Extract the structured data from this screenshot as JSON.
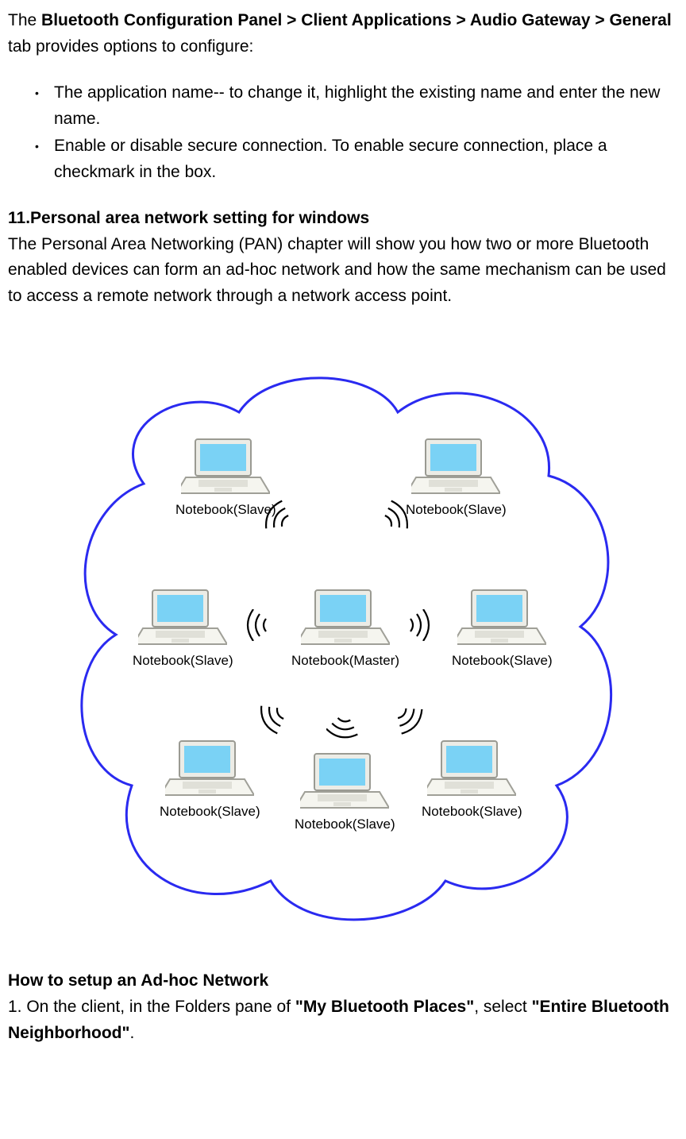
{
  "intro": {
    "prefix": "The ",
    "boldPath": "Bluetooth Configuration Panel > Client Applications > Audio Gateway > General",
    "suffix": " tab provides options to configure:"
  },
  "bullets": [
    "The application name-- to change it, highlight the existing name and enter the new name.",
    "Enable or disable secure connection. To enable secure connection, place a checkmark in the box."
  ],
  "section11": {
    "heading": "11.Personal area network setting for windows",
    "body": "The Personal Area Networking (PAN) chapter will show you how two or more Bluetooth enabled devices can form an ad-hoc network and how the same mechanism can be used to access a remote network through a network access point."
  },
  "diagram": {
    "nodes": {
      "topLeft": "Notebook(Slave)",
      "topRight": "Notebook(Slave)",
      "midLeft": "Notebook(Slave)",
      "center": "Notebook(Master)",
      "midRight": "Notebook(Slave)",
      "botLeft": "Notebook(Slave)",
      "botCenter": "Notebook(Slave)",
      "botRight": "Notebook(Slave)"
    }
  },
  "howto": {
    "heading": "How to setup an Ad-hoc Network",
    "step1_a": "1. On the client, in the Folders pane of ",
    "step1_b": "\"My Bluetooth Places\"",
    "step1_c": ", select ",
    "step1_d": "\"Entire Bluetooth Neighborhood\"",
    "step1_e": "."
  }
}
